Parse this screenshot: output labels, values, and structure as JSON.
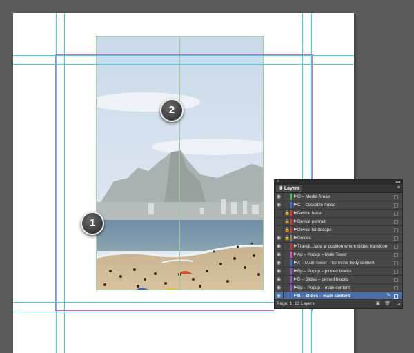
{
  "page_markers": [
    {
      "label": "1"
    },
    {
      "label": "2"
    }
  ],
  "layers_panel": {
    "tab_label": "Layers",
    "close_glyph": "×",
    "collapse_glyph": "◂◂",
    "menu_glyph": "≡",
    "footer_info": "Page: 1, 13 Layers",
    "new_layer_icon": "new-layer-icon",
    "delete_icon": "trash-icon",
    "layers": [
      {
        "name": "O – Media Areas",
        "color": "#3fc94a",
        "visible": true,
        "locked": false,
        "selected": false
      },
      {
        "name": "C – Clickable Areas",
        "color": "#3a6df0",
        "visible": true,
        "locked": false,
        "selected": false
      },
      {
        "name": "Device bezel",
        "color": "#e0342a",
        "visible": false,
        "locked": true,
        "selected": false
      },
      {
        "name": "Device portrait",
        "color": "#e0342a",
        "visible": false,
        "locked": true,
        "selected": false
      },
      {
        "name": "Device landscape",
        "color": "#e0342a",
        "visible": false,
        "locked": true,
        "selected": false
      },
      {
        "name": "Guides",
        "color": "#8a8a8a",
        "visible": true,
        "locked": true,
        "selected": false
      },
      {
        "name": "Transit...lace at position where slides transition",
        "color": "#e0342a",
        "visible": true,
        "locked": false,
        "selected": false
      },
      {
        "name": "Ap – Popup – Main Tower",
        "color": "#e04fd0",
        "visible": true,
        "locked": false,
        "selected": false
      },
      {
        "name": "A – Main Tower – for inline body content",
        "color": "#3a6df0",
        "visible": true,
        "locked": false,
        "selected": false
      },
      {
        "name": "Bp – Popup – pinned blocks",
        "color": "#9a4fe0",
        "visible": true,
        "locked": false,
        "selected": false
      },
      {
        "name": "B – Slides – pinned blocks",
        "color": "#9a4fe0",
        "visible": true,
        "locked": false,
        "selected": false
      },
      {
        "name": "Bp – Popup – main content",
        "color": "#9a4fe0",
        "visible": true,
        "locked": false,
        "selected": false
      },
      {
        "name": "B – Slides – main content",
        "color": "#3a6df0",
        "visible": true,
        "locked": false,
        "selected": true
      }
    ]
  }
}
